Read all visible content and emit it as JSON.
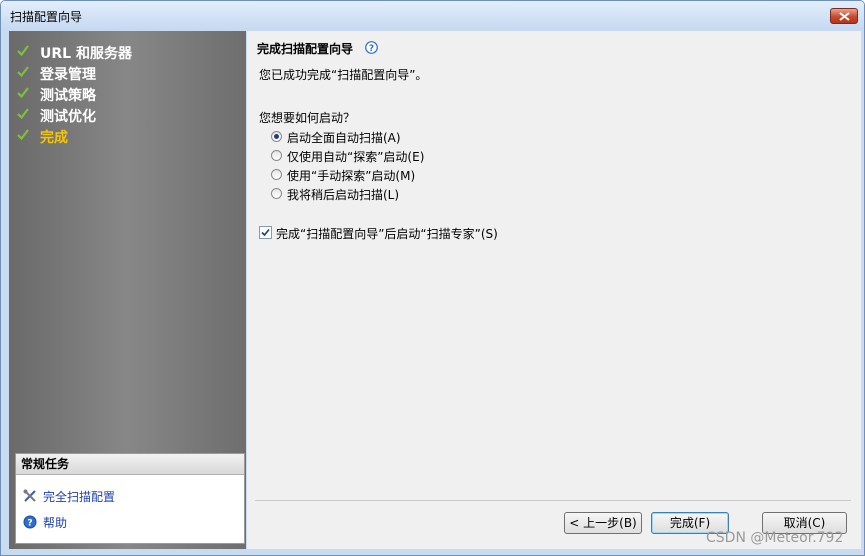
{
  "window": {
    "title": "扫描配置向导"
  },
  "steps": [
    {
      "label": "URL 和服务器",
      "done": true
    },
    {
      "label": "登录管理",
      "done": true
    },
    {
      "label": "测试策略",
      "done": true
    },
    {
      "label": "测试优化",
      "done": true
    },
    {
      "label": "完成",
      "done": true,
      "current": true
    }
  ],
  "tasks": {
    "header": "常规任务",
    "items": [
      {
        "label": "完全扫描配置",
        "icon": "wrench-screwdriver-icon"
      },
      {
        "label": "帮助",
        "icon": "help-icon"
      }
    ]
  },
  "main": {
    "heading": "完成扫描配置向导",
    "success_text": "您已成功完成“扫描配置向导”。",
    "question": "您想要如何启动？",
    "options": [
      {
        "label": "启动全面自动扫描(A)",
        "selected": true
      },
      {
        "label": "仅使用自动“探索”启动(E)",
        "selected": false
      },
      {
        "label": "使用“手动探索”启动(M)",
        "selected": false
      },
      {
        "label": "我将稍后启动扫描(L)",
        "selected": false
      }
    ],
    "checkbox": {
      "label": "完成“扫描配置向导”后启动“扫描专家”(S)",
      "checked": true
    }
  },
  "buttons": {
    "back": "< 上一步(B)",
    "finish": "完成(F)",
    "cancel": "取消(C)"
  },
  "watermark": "CSDN @Meteor.792",
  "colors": {
    "current_step": "#f7c600",
    "link": "#1d3fb5",
    "panel": "#7a7a7a"
  }
}
